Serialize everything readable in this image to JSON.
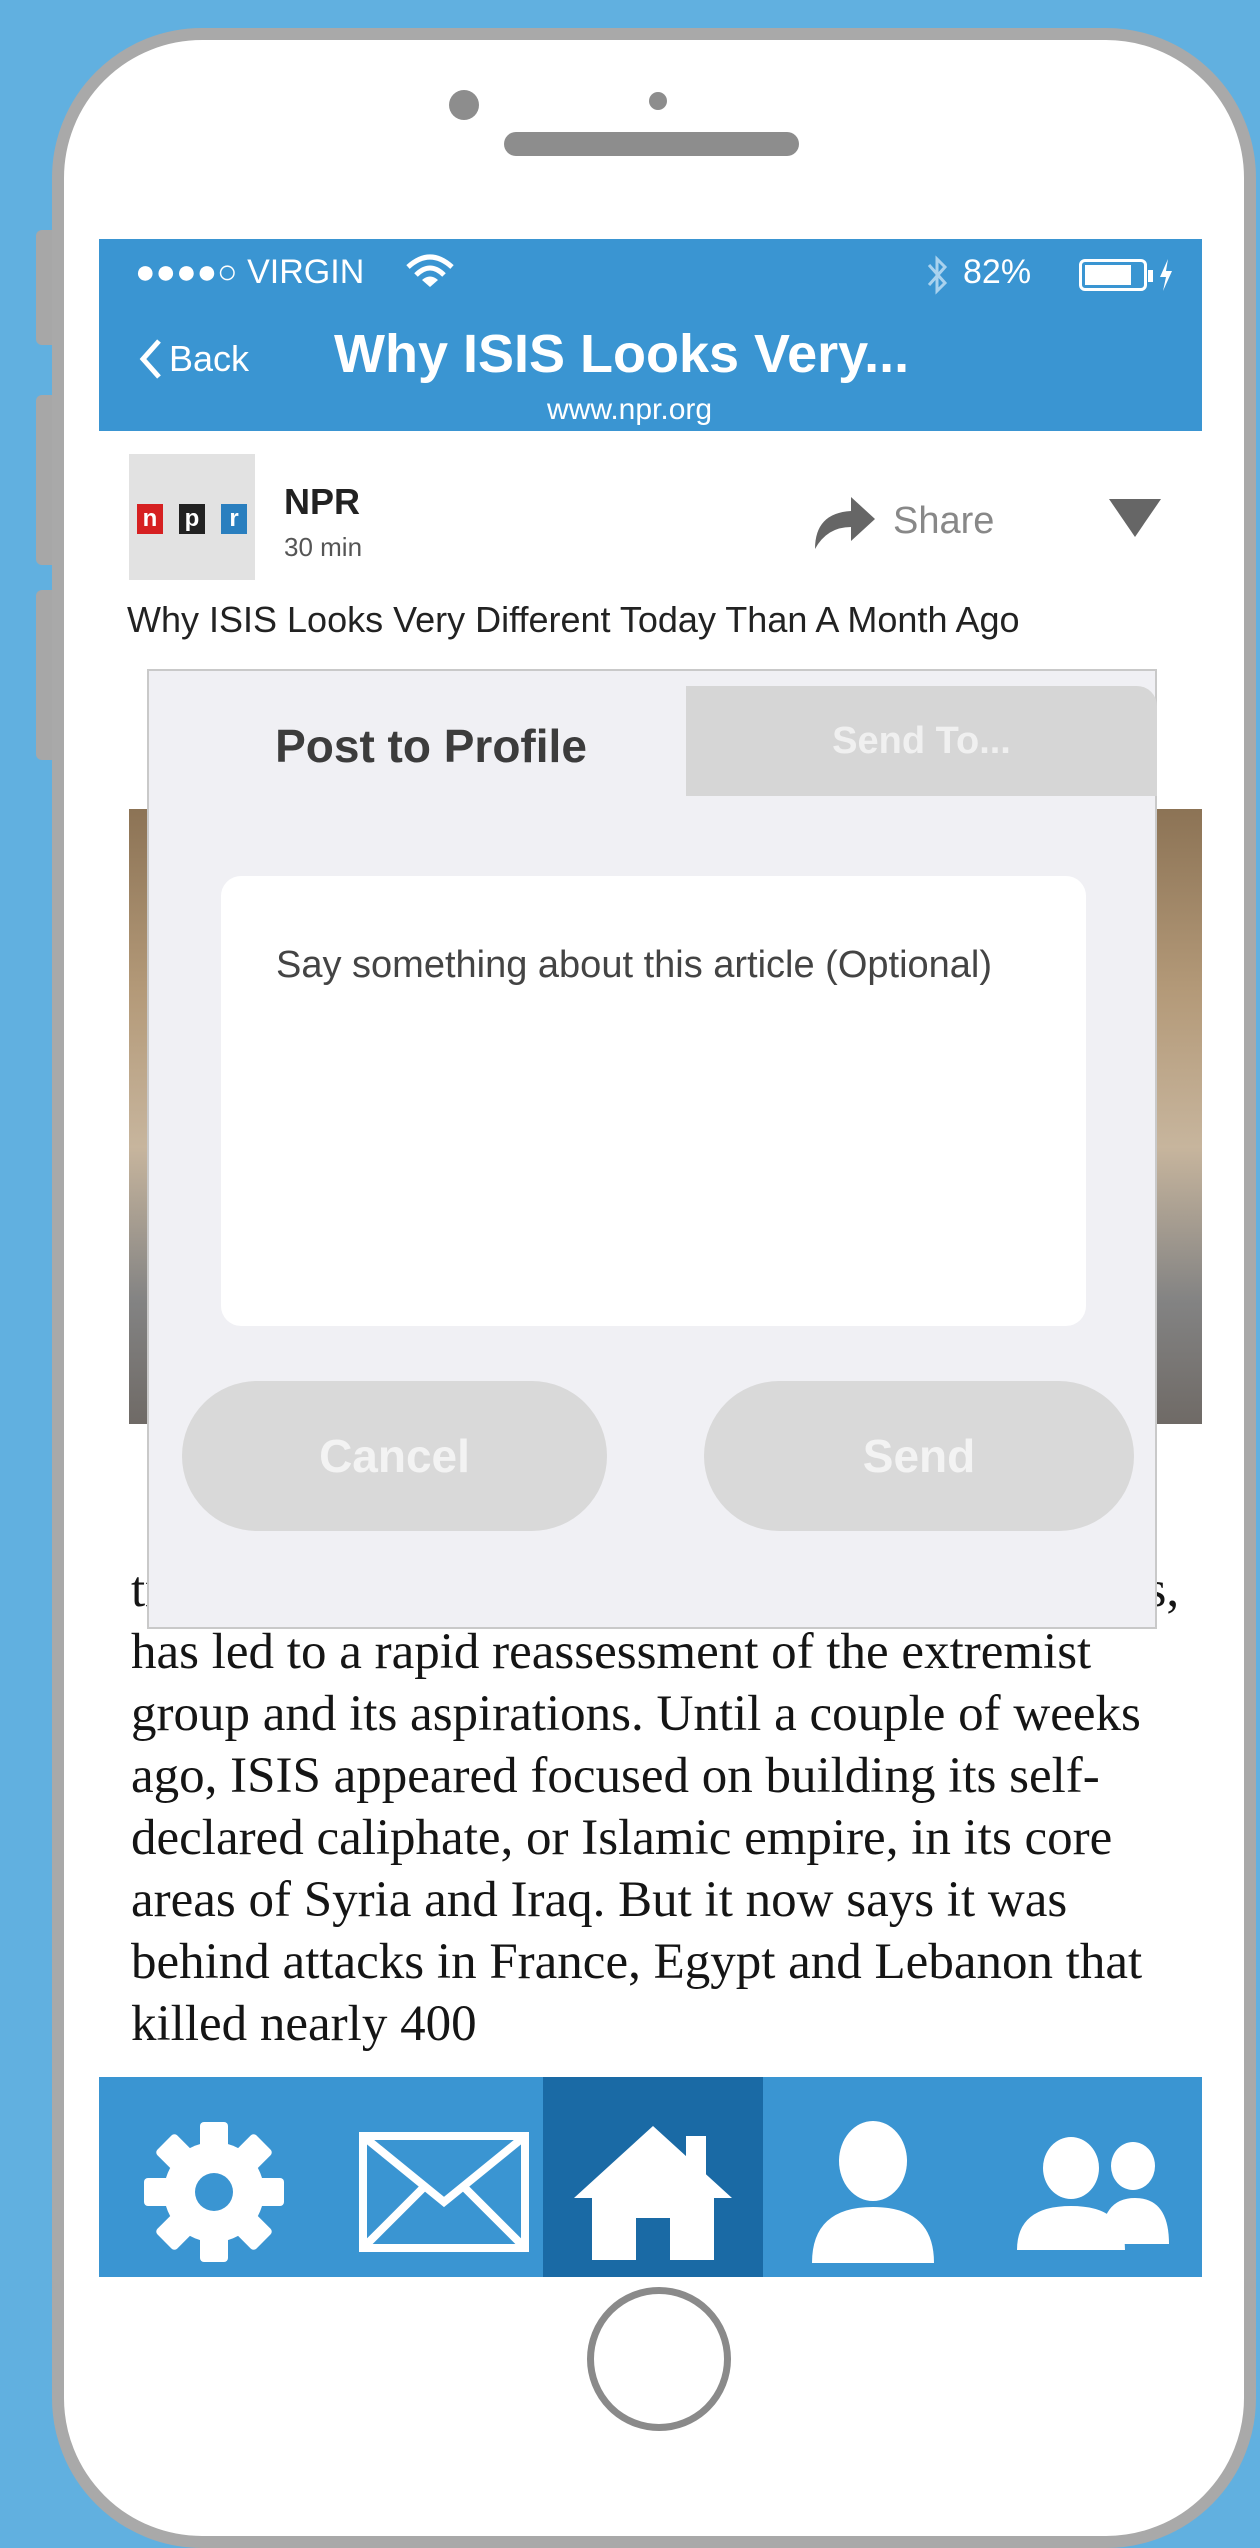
{
  "status_bar": {
    "carrier": "●●●●○ VIRGIN",
    "battery_percent": "82%",
    "wifi_icon": "wifi-icon",
    "bluetooth_icon": "bluetooth-icon"
  },
  "nav": {
    "back_label": "Back",
    "title": "Why ISIS Looks Very...",
    "url": "www.npr.org"
  },
  "post": {
    "source_name": "NPR",
    "age": "30 min",
    "share_label": "Share",
    "logo_letters": [
      "n",
      "p",
      "r"
    ],
    "headline_peek": "Why ISIS Looks Very Different Today Than A Month Ago",
    "body": "trio of major attacks, including the assault on Paris, has led to a rapid reassessment of the extremist group and its aspirations. Until a couple of weeks ago, ISIS appeared focused on building its self-declared caliphate, or Islamic empire, in its core areas of Syria and Iraq. But it now says it was behind attacks in France, Egypt and Lebanon that killed nearly 400"
  },
  "share_dialog": {
    "tabs": [
      "Post to Profile",
      "Send To..."
    ],
    "active_tab": "Post to Profile",
    "comment_placeholder": "Say something about this article (Optional)",
    "cancel_label": "Cancel",
    "send_label": "Send"
  },
  "tab_bar": {
    "items": [
      "settings-icon",
      "mail-icon",
      "home-icon",
      "profile-icon",
      "friends-icon"
    ],
    "active": "home-icon"
  },
  "colors": {
    "accent": "#3a95d2",
    "accent_dark": "#1a6aa5",
    "background": "#61b0e0",
    "npr_red": "#d62021",
    "npr_black": "#222222",
    "npr_blue": "#2a7fbf"
  }
}
